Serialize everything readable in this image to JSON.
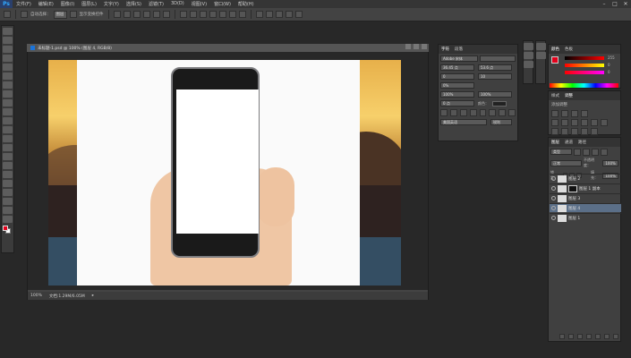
{
  "app": {
    "logo": "Ps"
  },
  "menu": [
    "文件(F)",
    "编辑(E)",
    "图像(I)",
    "图层(L)",
    "文字(Y)",
    "选择(S)",
    "滤镜(T)",
    "3D(D)",
    "视图(V)",
    "窗口(W)",
    "帮助(H)"
  ],
  "window_controls": [
    "–",
    "□",
    "✕"
  ],
  "options": {
    "auto_select": "自动选择：",
    "auto_select_value": "图层",
    "transform": "显示变换控件"
  },
  "document": {
    "title": "未标题-1.psd @ 100% (图层 4, RGB/8)",
    "zoom": "100%",
    "doc_info": "文档:1.29M/6.05M"
  },
  "character_panel": {
    "tabs": [
      "字符",
      "段落"
    ],
    "font": "Adobe 宋体",
    "size": "36.45 点",
    "leading": "53.6 点",
    "kerning": "0",
    "tracking": "10",
    "baseline": "0%",
    "vscale": "100%",
    "hscale": "100%",
    "shift": "0 点",
    "color_label": "颜色：",
    "lang": "美国英语",
    "aa": "锐利"
  },
  "color_panel": {
    "tabs": [
      "颜色",
      "色板"
    ],
    "r": "255",
    "g": "0",
    "b": "0"
  },
  "styles_panel": {
    "tabs": [
      "样式",
      "调整"
    ],
    "label": "添加调整"
  },
  "layers_panel": {
    "tabs": [
      "图层",
      "通道",
      "路径"
    ],
    "kind": "类型",
    "blend": "正常",
    "opacity_label": "不透明度：",
    "opacity": "100%",
    "lock_label": "锁定：",
    "fill_label": "填充：",
    "fill": "100%",
    "layers": [
      {
        "name": "图层 2",
        "selected": false,
        "mask": false
      },
      {
        "name": "图层 1 副本",
        "selected": false,
        "mask": true
      },
      {
        "name": "图层 3",
        "selected": false,
        "mask": false
      },
      {
        "name": "图层 4",
        "selected": true,
        "mask": false
      },
      {
        "name": "图层 1",
        "selected": false,
        "mask": false
      }
    ]
  },
  "colors": {
    "fg": "#e3001b",
    "bg": "#ffffff",
    "selected_layer": "#5b6f88"
  }
}
